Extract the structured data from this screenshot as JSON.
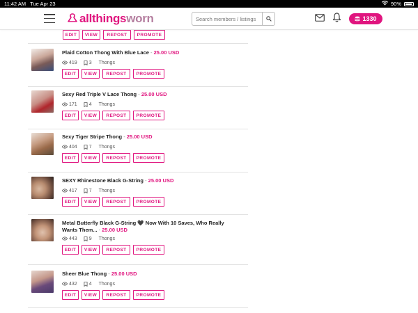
{
  "status_bar": {
    "time": "11:42 AM",
    "date": "Tue Apr 23",
    "battery": "90%"
  },
  "header": {
    "logo_part1": "allthings",
    "logo_part2": "worn",
    "search_placeholder": "Search members / listings",
    "coins": "1330",
    "brand_color": "#e0157f"
  },
  "buttons": {
    "edit": "EDIT",
    "view": "VIEW",
    "repost": "REPOST",
    "promote": "PROMOTE"
  },
  "listings": [
    {
      "title": "Plaid Cotton Thong With Blue Lace",
      "price": "25.00 USD",
      "views": "419",
      "saves": "3",
      "category": "Thongs"
    },
    {
      "title": "Sexy Red Triple V Lace Thong",
      "price": "25.00 USD",
      "views": "171",
      "saves": "4",
      "category": "Thongs"
    },
    {
      "title": "Sexy Tiger Stripe Thong",
      "price": "25.00 USD",
      "views": "404",
      "saves": "7",
      "category": "Thongs"
    },
    {
      "title": "SEXY Rhinestone Black G-String",
      "price": "25.00 USD",
      "views": "417",
      "saves": "7",
      "category": "Thongs"
    },
    {
      "title": "Metal Butterfly Black G-String 🖤 Now With 10 Saves, Who Really Wants Them...",
      "price": "25.00 USD",
      "views": "443",
      "saves": "9",
      "category": "Thongs"
    },
    {
      "title": "Sheer Blue Thong",
      "price": "25.00 USD",
      "views": "432",
      "saves": "4",
      "category": "Thongs"
    }
  ]
}
